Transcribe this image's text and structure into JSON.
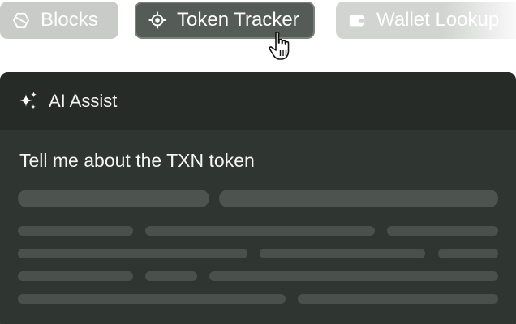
{
  "tabs": {
    "blocks": {
      "label": "Blocks",
      "icon": "hexagon-icon"
    },
    "token_tracker": {
      "label": "Token Tracker",
      "icon": "crosshair-icon",
      "active": true
    },
    "wallet_lookup": {
      "label": "Wallet Lookup",
      "icon": "wallet-icon"
    }
  },
  "assist_panel": {
    "title": "AI Assist",
    "icon": "sparkle-icon",
    "query": "Tell me about the TXN token"
  },
  "colors": {
    "panel_bg": "#2f3531",
    "panel_header_bg": "#262b27",
    "active_tab_bg": "#555b56",
    "inactive_tab_bg": "#c9cbc9",
    "skeleton": "#4a504c"
  }
}
